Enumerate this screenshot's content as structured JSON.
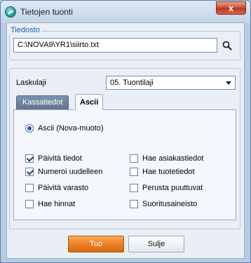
{
  "window": {
    "title": "Tietojen tuonti",
    "close_glyph": "x"
  },
  "file_group": {
    "label": "Tiedosto",
    "path_value": "C:\\NOVA9\\YR1\\siirto.txt",
    "browse_icon": "search-icon"
  },
  "type_row": {
    "label": "Laskulaji",
    "selected": "05. Tuontilaji"
  },
  "tabs": [
    {
      "label": "Kassatiedot",
      "active": false
    },
    {
      "label": "Ascii",
      "active": true
    }
  ],
  "format": {
    "radio_label": "Ascii (Nova-muoto)",
    "selected": true
  },
  "options_left": [
    {
      "label": "Päivitä tiedot",
      "checked": true
    },
    {
      "label": "Numeroi uudelleen",
      "checked": true
    },
    {
      "label": "Päivitä varasto",
      "checked": false
    },
    {
      "label": "Hae hinnat",
      "checked": false
    }
  ],
  "options_right": [
    {
      "label": "Hae asiakastiedot",
      "checked": false
    },
    {
      "label": "Hae tuotetiedot",
      "checked": false
    },
    {
      "label": "Perusta puuttuvat",
      "checked": false
    },
    {
      "label": "Suoritusaineisto",
      "checked": false
    }
  ],
  "buttons": {
    "import_label": "Tuo",
    "close_label": "Sulje"
  },
  "colors": {
    "accent_orange": "#ea7d21",
    "group_label_blue": "#1d5bb1",
    "window_frame": "#b7cbe3"
  }
}
